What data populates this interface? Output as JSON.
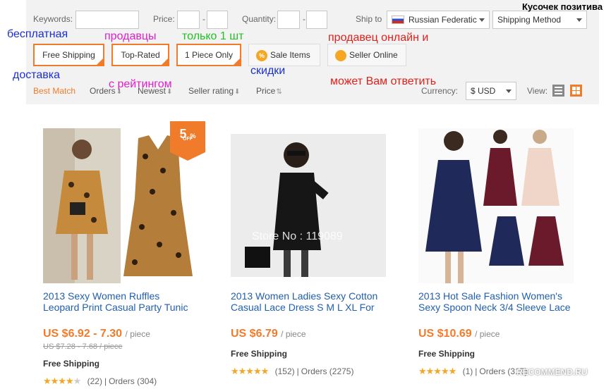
{
  "filters": {
    "keywords_label": "Keywords:",
    "keywords_value": "",
    "price_label": "Price:",
    "price_dash": "-",
    "quantity_label": "Quantity:",
    "quantity_dash": "-",
    "ship_to_label": "Ship to",
    "ship_to_value": "Russian Federatic",
    "shipping_method": "Shipping Method"
  },
  "quick_filters": {
    "free_shipping": "Free Shipping",
    "top_rated": "Top-Rated",
    "one_piece": "1 Piece Only",
    "sale_items": "Sale Items",
    "sale_icon": "%",
    "seller_online": "Seller Online"
  },
  "sort": {
    "best_match": "Best Match",
    "orders": "Orders",
    "newest": "Newest",
    "seller_rating": "Seller rating",
    "price": "Price",
    "currency_label": "Currency:",
    "currency_value": "$ USD",
    "view_label": "View:"
  },
  "annotations": {
    "top_right": "Кусочек позитива",
    "free_1": "бесплатная",
    "free_2": "доставка",
    "rated_1": "продавцы",
    "rated_2": "с рейтингом",
    "one_piece": "только 1 шт",
    "discounts": "скидки",
    "seller_1": "продавец онлайн и",
    "seller_2": "может Вам ответить"
  },
  "products": [
    {
      "title_line1": "2013 Sexy Women Ruffles",
      "title_line2": "Leopard Print Casual Party Tunic",
      "price": "US $6.92 - 7.30",
      "unit": "/ piece",
      "old_price": "US $7.28 - 7.68 / piece",
      "shipping": "Free Shipping",
      "rating": 4,
      "reviews": "(22)",
      "orders": "Orders (304)",
      "badge_pct": "5",
      "badge_sym": "%",
      "badge_off": "OFF"
    },
    {
      "title_line1": "2013 Women Ladies Sexy Cotton",
      "title_line2": "Casual Lace Dress S M L XL For",
      "price": "US $6.79",
      "unit": "/ piece",
      "shipping": "Free Shipping",
      "rating": 5,
      "reviews": "(152)",
      "orders": "Orders (2275)",
      "watermark": "Store No : 119089"
    },
    {
      "title_line1": "2013 Hot Sale Fashion Women's",
      "title_line2": "Sexy Spoon Neck 3/4 Sleeve Lace",
      "price": "US $10.69",
      "unit": "/ piece",
      "shipping": "Free Shipping",
      "rating": 5,
      "reviews": "(1)",
      "orders": "Orders (315)"
    }
  ],
  "site_watermark": "RECOMMEND.RU",
  "colors": {
    "accent": "#f07b2b",
    "link": "#1f5fb0",
    "panel": "#f2f2f2"
  }
}
